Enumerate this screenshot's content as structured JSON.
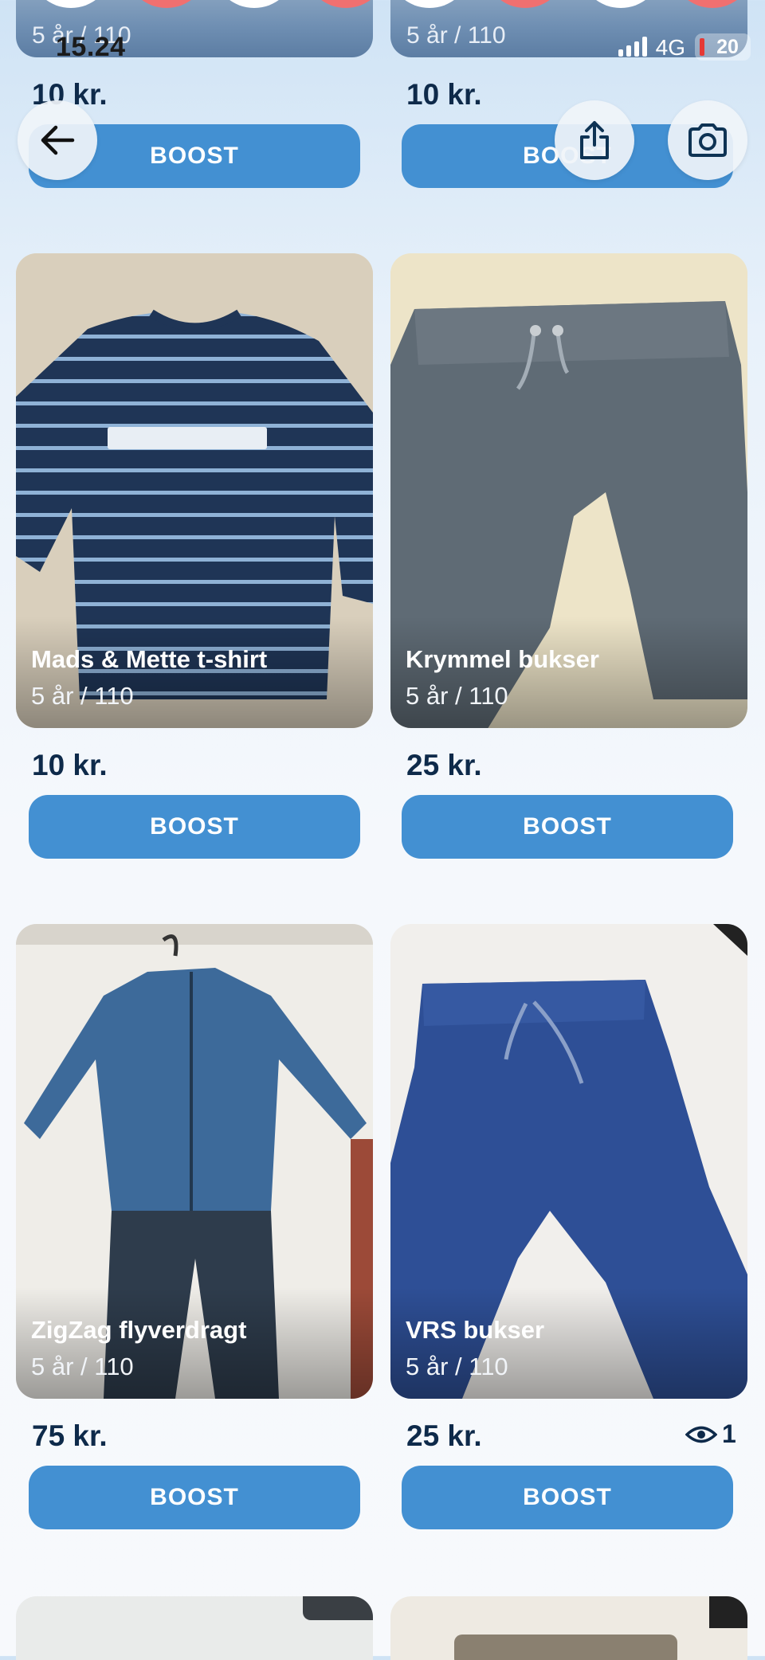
{
  "status_bar": {
    "time": "15.24",
    "network": "4G",
    "battery": "20"
  },
  "header": {
    "back_label": "",
    "share_label": "",
    "camera_label": ""
  },
  "top_row": [
    {
      "subtitle": "5 år / 110",
      "price": "10 kr.",
      "boost": "BOOST"
    },
    {
      "subtitle": "5 år / 110",
      "price": "10 kr.",
      "boost": "BOOST"
    }
  ],
  "items": [
    {
      "title": "Mads & Mette t-shirt",
      "subtitle": "5 år / 110",
      "price": "10 kr.",
      "boost": "BOOST"
    },
    {
      "title": "Krymmel bukser",
      "subtitle": "5 år / 110",
      "price": "25 kr.",
      "boost": "BOOST"
    },
    {
      "title": "ZigZag flyverdragt",
      "subtitle": "5 år / 110",
      "price": "75 kr.",
      "boost": "BOOST"
    },
    {
      "title": "VRS bukser",
      "subtitle": "5 år / 110",
      "price": "25 kr.",
      "boost": "BOOST",
      "views": "1"
    }
  ],
  "colors": {
    "boost": "#4390d2",
    "price": "#0e2a4a",
    "accent_red": "#f06b6b"
  }
}
